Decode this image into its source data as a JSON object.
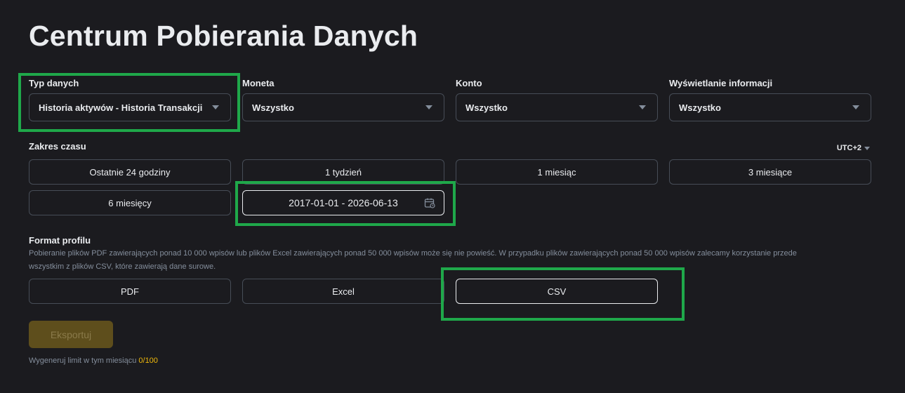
{
  "page": {
    "title": "Centrum Pobierania Danych"
  },
  "filters": {
    "data_type": {
      "label": "Typ danych",
      "value": "Historia aktywów - Historia Transakcji"
    },
    "coin": {
      "label": "Moneta",
      "value": "Wszystko"
    },
    "account": {
      "label": "Konto",
      "value": "Wszystko"
    },
    "display": {
      "label": "Wyświetlanie informacji",
      "value": "Wszystko"
    }
  },
  "time_range": {
    "label": "Zakres czasu",
    "timezone": "UTC+2",
    "options": [
      "Ostatnie 24 godziny",
      "1 tydzień",
      "1 miesiąc",
      "3 miesiące",
      "6 miesięcy"
    ],
    "custom_range": "2017-01-01 - 2026-06-13"
  },
  "format": {
    "label": "Format profilu",
    "note_line1": "Pobieranie plików PDF zawierających ponad 10 000 wpisów lub plików Excel zawierających ponad 50 000 wpisów może się nie powieść. W przypadku plików zawierających ponad 50 000 wpisów zalecamy korzystanie przede",
    "note_line2": "wszystkim z plików CSV, które zawierają dane surowe.",
    "options": [
      "PDF",
      "Excel",
      "CSV"
    ],
    "selected": "CSV"
  },
  "export": {
    "button_label": "Eksportuj",
    "limit_text": "Wygeneruj limit w tym miesiącu",
    "limit_count": "0/100"
  },
  "colors": {
    "background": "#1b1b1f",
    "highlight": "#1fa84a",
    "accent": "#f0b90b",
    "export_disabled_bg": "#5e4e1c"
  },
  "icons": {
    "select_caret": "chevron-down-icon",
    "calendar": "calendar-icon"
  }
}
